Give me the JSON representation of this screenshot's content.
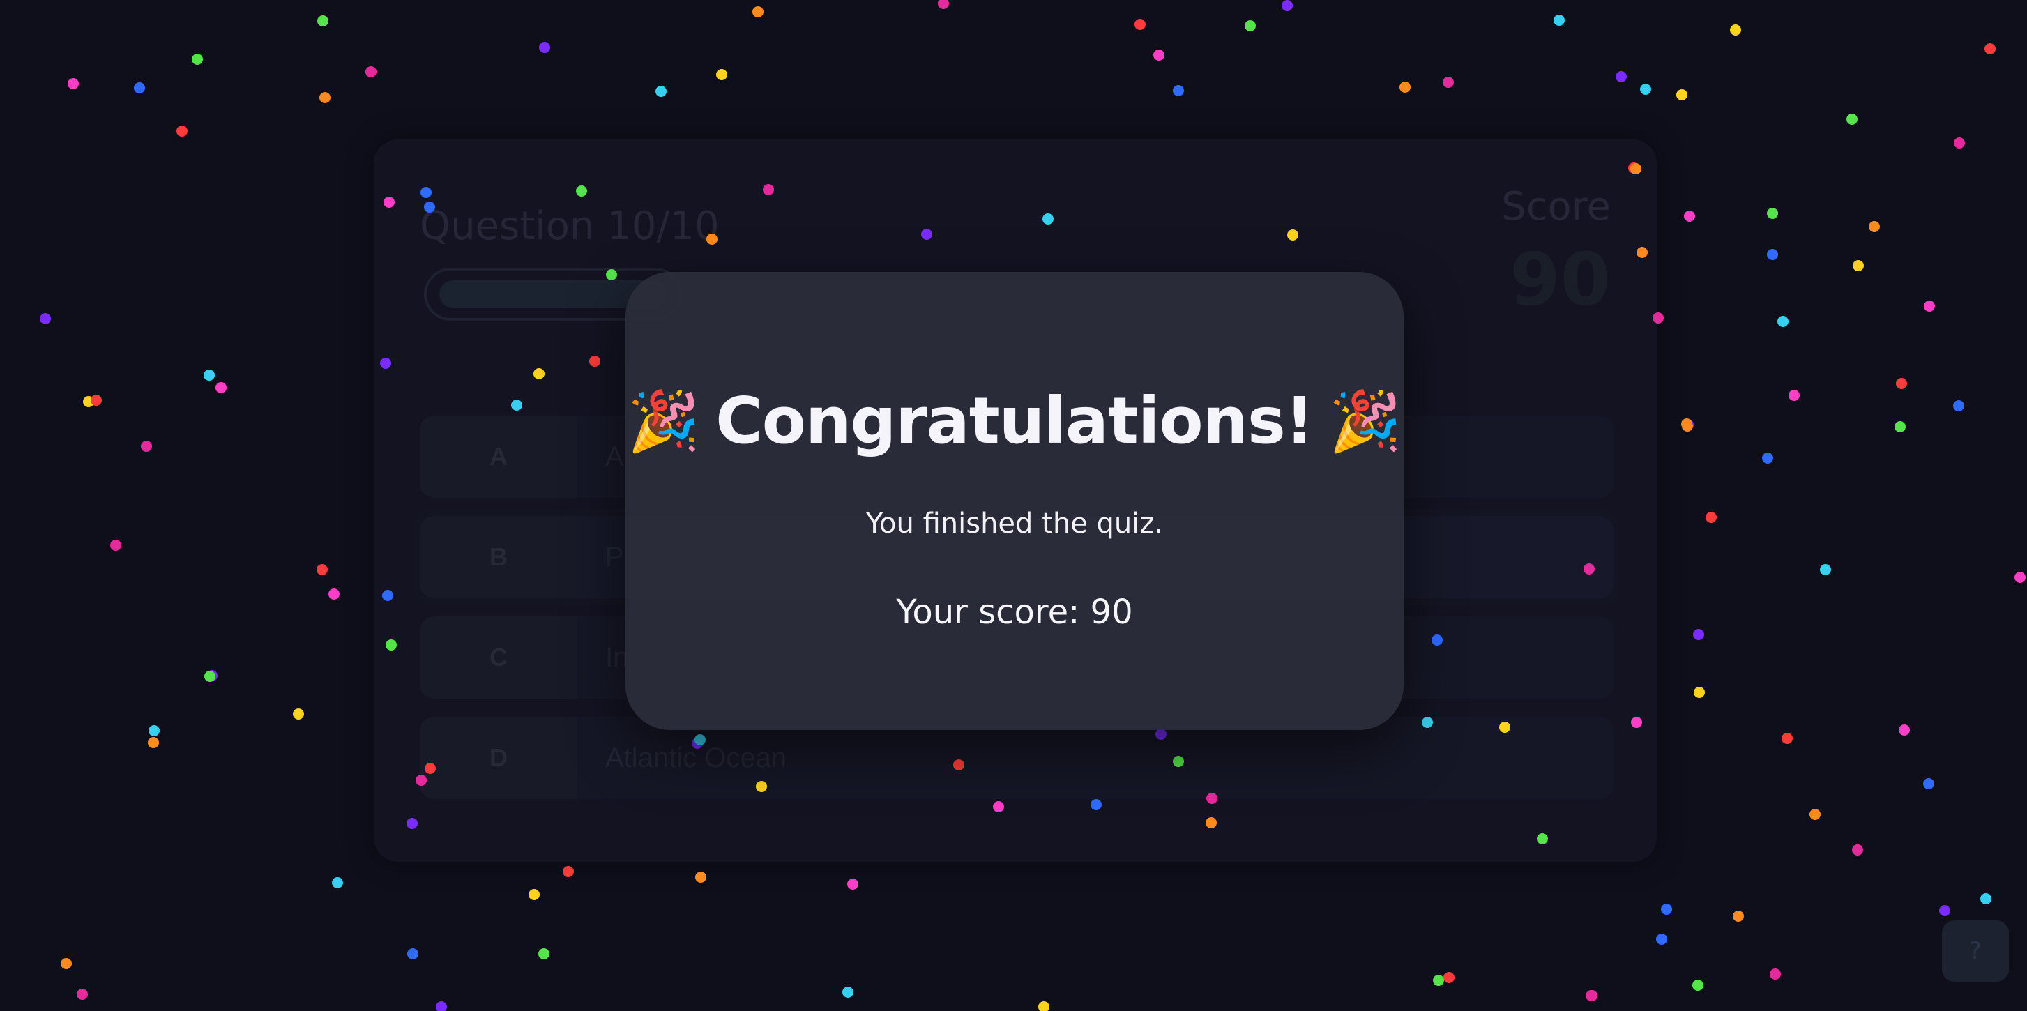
{
  "quiz": {
    "question_label": "Question 10/10",
    "progress": 1.0,
    "score_label": "Score",
    "score_value": "90",
    "options": [
      {
        "letter": "A",
        "text": "A"
      },
      {
        "letter": "B",
        "text": "P"
      },
      {
        "letter": "C",
        "text": "In"
      },
      {
        "letter": "D",
        "text": "Atlantic Ocean"
      }
    ]
  },
  "modal": {
    "popper_left": "🎉",
    "title": "Congratulations!",
    "popper_right": "🎉",
    "subtitle": "You finished the quiz.",
    "score_text": "Your score: 90"
  },
  "help_button": {
    "label": "?"
  },
  "confetti": {
    "colors": [
      "#ff3b3b",
      "#ff8a1f",
      "#ffd21f",
      "#55e54a",
      "#38d0f0",
      "#2f6bff",
      "#7a2cff",
      "#ff3ec8",
      "#e62a9c"
    ]
  }
}
